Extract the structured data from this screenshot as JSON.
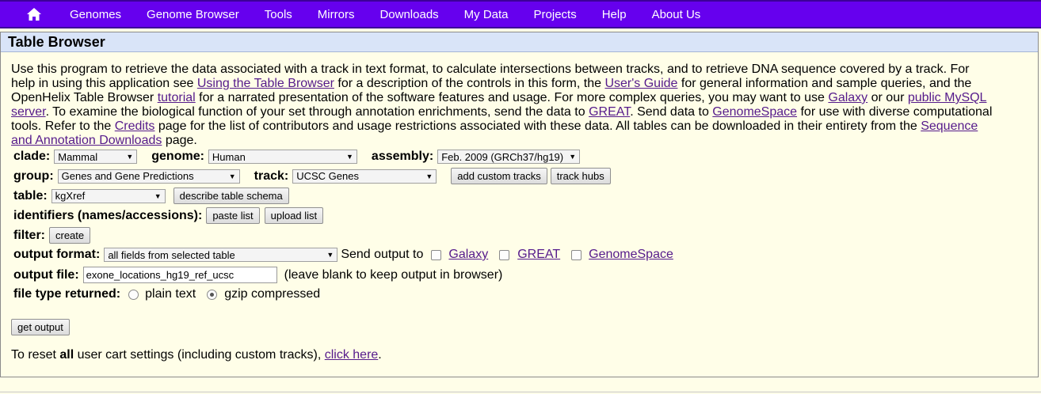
{
  "nav": {
    "items": [
      "Genomes",
      "Genome Browser",
      "Tools",
      "Mirrors",
      "Downloads",
      "My Data",
      "Projects",
      "Help",
      "About Us"
    ],
    "home_icon": "home-icon",
    "color": "#6600ee"
  },
  "panel": {
    "title": "Table Browser"
  },
  "intro": {
    "t1": "Use this program to retrieve the data associated with a track in text format, to calculate intersections between tracks, and to retrieve DNA sequence covered by a track. For help in using this application see ",
    "l1": "Using the Table Browser",
    "t2": " for a description of the controls in this form, the ",
    "l2": "User's Guide",
    "t3": " for general information and sample queries, and the OpenHelix Table Browser ",
    "l3": "tutorial",
    "t4": " for a narrated presentation of the software features and usage. For more complex queries, you may want to use ",
    "l4": "Galaxy",
    "t5": " or our ",
    "l5": "public MySQL server",
    "t6": ". To examine the biological function of your set through annotation enrichments, send the data to ",
    "l6": "GREAT",
    "t7": ". Send data to ",
    "l7": "GenomeSpace",
    "t8": " for use with diverse computational tools. Refer to the ",
    "l8": "Credits",
    "t9": " page for the list of contributors and usage restrictions associated with these data. All tables can be downloaded in their entirety from the ",
    "l9": "Sequence and Annotation Downloads",
    "t10": " page."
  },
  "form": {
    "clade_label": "clade:",
    "clade_value": "Mammal",
    "genome_label": "genome:",
    "genome_value": "Human",
    "assembly_label": "assembly:",
    "assembly_value": "Feb. 2009 (GRCh37/hg19)",
    "group_label": "group:",
    "group_value": "Genes and Gene Predictions",
    "track_label": "track:",
    "track_value": "UCSC Genes",
    "add_custom_tracks": "add custom tracks",
    "track_hubs": "track hubs",
    "table_label": "table:",
    "table_value": "kgXref",
    "describe_schema": "describe table schema",
    "identifiers_label": "identifiers (names/accessions):",
    "paste_list": "paste list",
    "upload_list": "upload list",
    "filter_label": "filter:",
    "create": "create",
    "output_format_label": "output format:",
    "output_format_value": "all fields from selected table",
    "send_output_to": "Send output to",
    "send_galaxy": "Galaxy",
    "send_great": "GREAT",
    "send_genomespace": "GenomeSpace",
    "output_file_label": "output file:",
    "output_file_value": "exone_locations_hg19_ref_ucsc",
    "output_file_hint": "(leave blank to keep output in browser)",
    "file_type_label": "file type returned:",
    "plain_text": "plain text",
    "gzip_compressed": "gzip compressed",
    "get_output": "get output"
  },
  "reset": {
    "t1": "To reset ",
    "bold": "all",
    "t2": " user cart settings (including custom tracks), ",
    "link": "click here",
    "t3": "."
  }
}
